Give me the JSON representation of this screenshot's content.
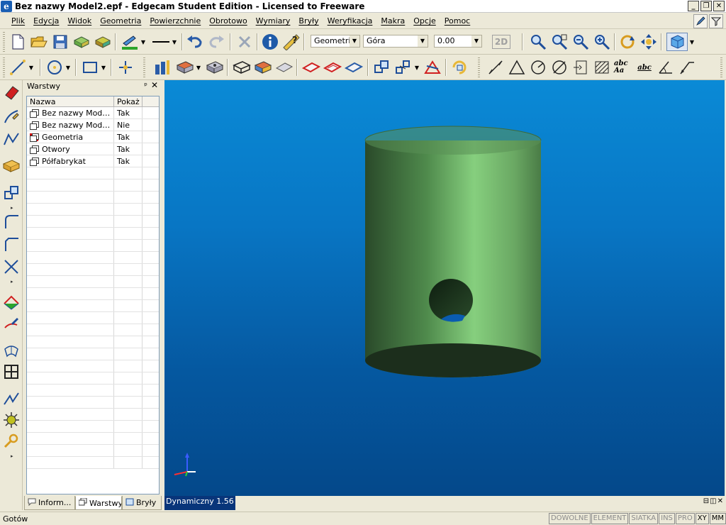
{
  "window": {
    "title": "Bez nazwy Model2.epf - Edgecam Student Edition - Licensed to Freeware",
    "icon_letter": "e",
    "min_label": "_",
    "restore_label": "❐",
    "close_label": "✕"
  },
  "menu": {
    "items": [
      "Plik",
      "Edycja",
      "Widok",
      "Geometria",
      "Powierzchnie",
      "Obrotowo",
      "Wymiary",
      "Bryły",
      "Weryfikacja",
      "Makra",
      "Opcje",
      "Pomoc"
    ]
  },
  "toolbar": {
    "mode_combo": "Geometria",
    "view_combo": "Góra",
    "depth_combo": "0.00",
    "btn_2d": "2D",
    "text_icon_1": "abc Aa",
    "text_icon_2": "abc"
  },
  "layers_panel": {
    "title": "Warstwy",
    "pin": "ᵖ",
    "close": "✕",
    "columns": [
      "Nazwa",
      "Pokaż"
    ],
    "rows": [
      {
        "name": "Bez nazwy Model...",
        "show": "Tak",
        "active": false
      },
      {
        "name": "Bez nazwy Model...",
        "show": "Nie",
        "active": false
      },
      {
        "name": "Geometria",
        "show": "Tak",
        "active": true
      },
      {
        "name": "Otwory",
        "show": "Tak",
        "active": false
      },
      {
        "name": "Półfabrykat",
        "show": "Tak",
        "active": false
      }
    ],
    "empty_rows": 25,
    "tabs": [
      {
        "label": "Inform...",
        "icon": "speech-bubble-icon",
        "active": false
      },
      {
        "label": "Warstwy",
        "icon": "layers-icon",
        "active": true
      },
      {
        "label": "Bryły",
        "icon": "solid-icon",
        "active": false
      }
    ]
  },
  "viewport": {
    "zoom_label": "Dynamiczny 1.56",
    "bg_top": "#0a8ad6",
    "bg_bottom": "#04488a",
    "model_color": "#6fbf6a"
  },
  "status": {
    "text": "Gotów",
    "indicators": [
      {
        "label": "DOWOLNE",
        "on": false
      },
      {
        "label": "ELEMENT",
        "on": false
      },
      {
        "label": "SIATKA",
        "on": false
      },
      {
        "label": "INS",
        "on": false
      },
      {
        "label": "PRO",
        "on": false
      },
      {
        "label": "XY",
        "on": true
      },
      {
        "label": "MM",
        "on": true
      }
    ]
  }
}
